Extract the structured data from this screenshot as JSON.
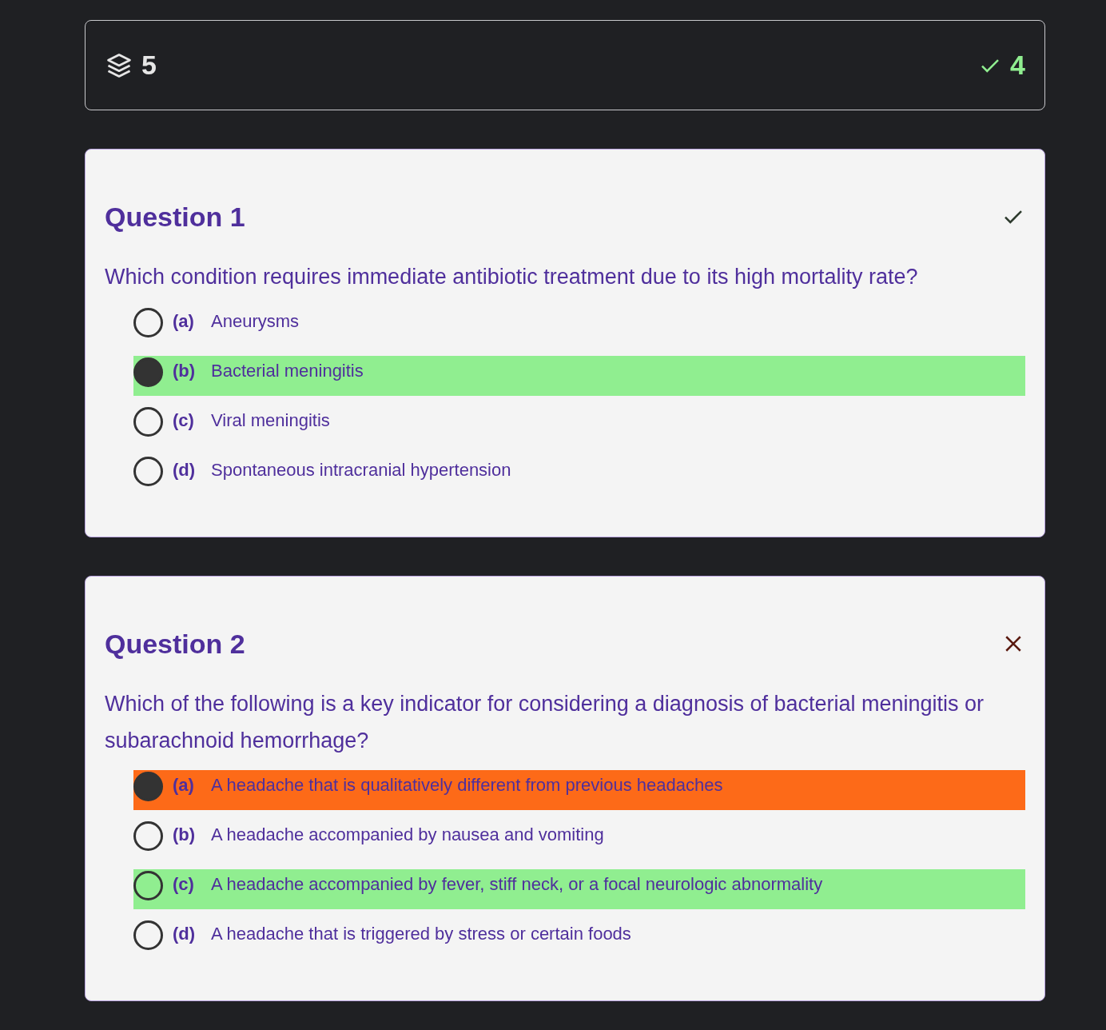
{
  "summary": {
    "total": "5",
    "correct": "4"
  },
  "questions": [
    {
      "title": "Question 1",
      "correct": true,
      "text": "Which condition requires immediate antibiotic treatment due to its high mortality rate?",
      "options": [
        {
          "letter": "(a)",
          "text": "Aneurysms",
          "selected": false,
          "correct": false
        },
        {
          "letter": "(b)",
          "text": "Bacterial meningitis",
          "selected": true,
          "correct": true
        },
        {
          "letter": "(c)",
          "text": "Viral meningitis",
          "selected": false,
          "correct": false
        },
        {
          "letter": "(d)",
          "text": "Spontaneous intracranial hypertension",
          "selected": false,
          "correct": false
        }
      ]
    },
    {
      "title": "Question 2",
      "correct": false,
      "text": "Which of the following is a key indicator for considering a diagnosis of bacterial meningitis or subarachnoid hemorrhage?",
      "options": [
        {
          "letter": "(a)",
          "text": "A headache that is qualitatively different from previous headaches",
          "selected": true,
          "correct": false
        },
        {
          "letter": "(b)",
          "text": "A headache accompanied by nausea and vomiting",
          "selected": false,
          "correct": false
        },
        {
          "letter": "(c)",
          "text": "A headache accompanied by fever, stiff neck, or a focal neurologic abnormality",
          "selected": false,
          "correct": true
        },
        {
          "letter": "(d)",
          "text": "A headache that is triggered by stress or certain foods",
          "selected": false,
          "correct": false
        }
      ]
    }
  ]
}
